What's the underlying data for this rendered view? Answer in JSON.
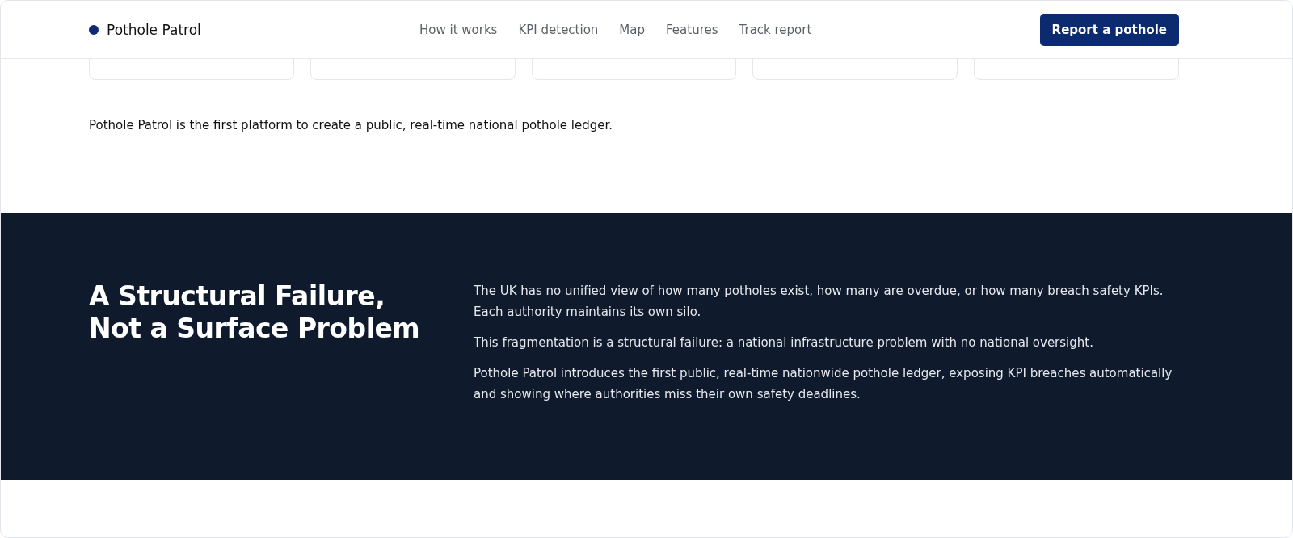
{
  "header": {
    "brand": "Pothole Patrol",
    "nav": [
      {
        "label": "How it works"
      },
      {
        "label": "KPI detection"
      },
      {
        "label": "Map"
      },
      {
        "label": "Features"
      },
      {
        "label": "Track report"
      }
    ],
    "cta": "Report a pothole"
  },
  "cards": [
    {
      "kind": "stat"
    },
    {
      "kind": "stat"
    },
    {
      "kind": "stat"
    },
    {
      "kind": "stat"
    },
    {
      "kind": "stat"
    }
  ],
  "intro": "Pothole Patrol is the first platform to create a public, real-time national pothole ledger.",
  "problem": {
    "heading": "A Structural Failure, Not a Surface Problem",
    "paragraphs": [
      "The UK has no unified view of how many potholes exist, how many are overdue, or how many breach safety KPIs. Each authority maintains its own silo.",
      "This fragmentation is a structural failure: a national infrastructure problem with no national oversight.",
      "Pothole Patrol introduces the first public, real-time nationwide pothole ledger, exposing KPI breaches automatically and showing where authorities miss their own safety deadlines."
    ]
  }
}
